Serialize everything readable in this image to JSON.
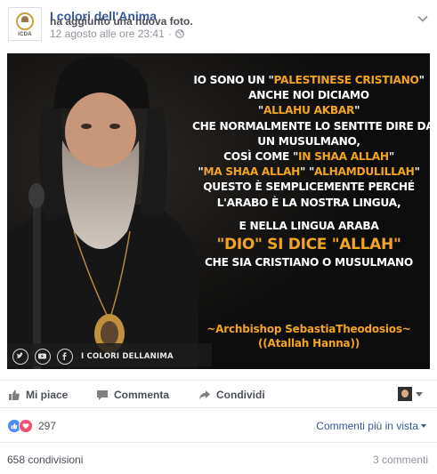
{
  "post": {
    "page_name": "I colori dell'Anima",
    "action_text": "ha aggiunto una nuova foto.",
    "timestamp": "12 agosto alle ore 23:41",
    "avatar_text": "ICDA"
  },
  "image": {
    "quote_lines": [
      {
        "parts": [
          {
            "t": "IO SONO UN \"",
            "hl": false
          },
          {
            "t": "PALESTINESE CRISTIANO",
            "hl": true
          },
          {
            "t": "\"",
            "hl": false
          }
        ]
      },
      {
        "parts": [
          {
            "t": "ANCHE NOI DICIAMO",
            "hl": false
          }
        ]
      },
      {
        "parts": [
          {
            "t": "\"",
            "hl": false
          },
          {
            "t": "ALLAHU AKBAR",
            "hl": true
          },
          {
            "t": "\"",
            "hl": false
          }
        ]
      },
      {
        "parts": [
          {
            "t": "CHE NORMALMENTE LO SENTITE DIRE DA",
            "hl": false
          }
        ]
      },
      {
        "parts": [
          {
            "t": "UN MUSULMANO,",
            "hl": false
          }
        ]
      },
      {
        "parts": [
          {
            "t": "COSÌ COME \"",
            "hl": false
          },
          {
            "t": "IN SHAA ALLAH",
            "hl": true
          },
          {
            "t": "\"",
            "hl": false
          }
        ]
      },
      {
        "parts": [
          {
            "t": "\"",
            "hl": false
          },
          {
            "t": "MA SHAA ALLAH",
            "hl": true
          },
          {
            "t": "\"  \"",
            "hl": false
          },
          {
            "t": "ALHAMDULILLAH",
            "hl": true
          },
          {
            "t": "\"",
            "hl": false
          }
        ]
      },
      {
        "parts": [
          {
            "t": "QUESTO È SEMPLICEMENTE PERCHÉ",
            "hl": false
          }
        ]
      },
      {
        "parts": [
          {
            "t": "L'ARABO È LA NOSTRA LINGUA,",
            "hl": false
          }
        ]
      },
      {
        "parts": [
          {
            "t": "E NELLA LINGUA ARABA",
            "hl": false
          }
        ],
        "gap": true
      },
      {
        "parts": [
          {
            "t": "\"DIO\" SI DICE  \"ALLAH\"",
            "hl": true
          }
        ],
        "big": true
      },
      {
        "parts": [
          {
            "t": "CHE SIA CRISTIANO O MUSULMANO",
            "hl": false
          }
        ]
      }
    ],
    "signature_line1": "~Archbishop SebastiaTheodosios~",
    "signature_line2": "((Atallah Hanna))",
    "brand_label": "I COLORI DELLANIMA",
    "social_icons": [
      "twitter-icon",
      "youtube-icon",
      "facebook-icon"
    ],
    "accent_color": "#f2a321"
  },
  "actions": {
    "like": "Mi piace",
    "comment": "Commenta",
    "share": "Condividi"
  },
  "stats": {
    "reactions_count": "297",
    "sort_label": "Commenti più in vista",
    "shares": "658 condivisioni",
    "comments": "3 commenti"
  },
  "colors": {
    "link": "#365899",
    "like_blue": "#4c8bf5",
    "love_red": "#f0506e"
  }
}
